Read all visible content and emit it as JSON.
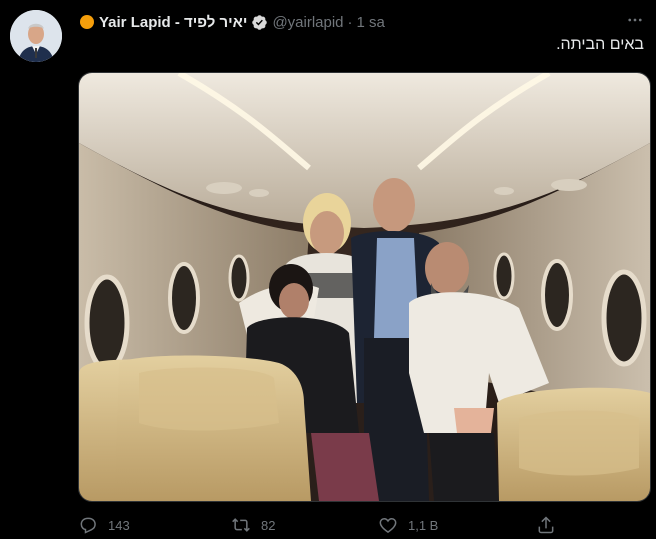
{
  "tweet": {
    "author_name": "Yair Lapid - יאיר לפיד",
    "handle": "@yairlapid",
    "separator": "·",
    "time": "1 sa",
    "text": "באים הביתה.",
    "more_label": "•••"
  },
  "actions": {
    "replies": "143",
    "retweets": "82",
    "likes": "1,1 B"
  },
  "colors": {
    "background": "#000000",
    "text": "#e7e9ea",
    "muted": "#71767b",
    "emoji_dot": "#f59e0b"
  },
  "icons": [
    "verified-badge-icon",
    "more-icon",
    "reply-icon",
    "retweet-icon",
    "like-icon",
    "share-icon"
  ]
}
